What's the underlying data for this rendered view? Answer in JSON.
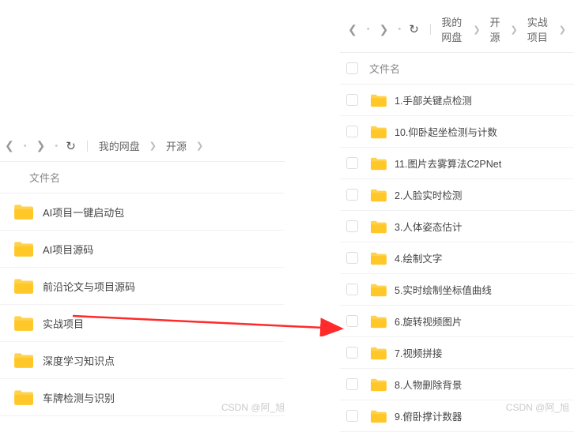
{
  "left": {
    "breadcrumb": [
      "我的网盘",
      "开源"
    ],
    "columnHeader": "文件名",
    "items": [
      {
        "label": "AI项目一键启动包"
      },
      {
        "label": "AI项目源码"
      },
      {
        "label": "前沿论文与项目源码"
      },
      {
        "label": "实战项目"
      },
      {
        "label": "深度学习知识点"
      },
      {
        "label": "车牌检测与识别"
      }
    ]
  },
  "right": {
    "breadcrumb": [
      "我的网盘",
      "开源",
      "实战项目"
    ],
    "columnHeader": "文件名",
    "items": [
      {
        "label": "1.手部关键点检测"
      },
      {
        "label": "10.仰卧起坐检测与计数"
      },
      {
        "label": "11.图片去雾算法C2PNet"
      },
      {
        "label": "2.人脸实时检测"
      },
      {
        "label": "3.人体姿态估计"
      },
      {
        "label": "4.绘制文字"
      },
      {
        "label": "5.实时绘制坐标值曲线"
      },
      {
        "label": "6.旋转视频图片"
      },
      {
        "label": "7.视频拼接"
      },
      {
        "label": "8.人物删除背景"
      },
      {
        "label": "9.俯卧撑计数器"
      }
    ]
  },
  "watermark": "CSDN @阿_旭"
}
